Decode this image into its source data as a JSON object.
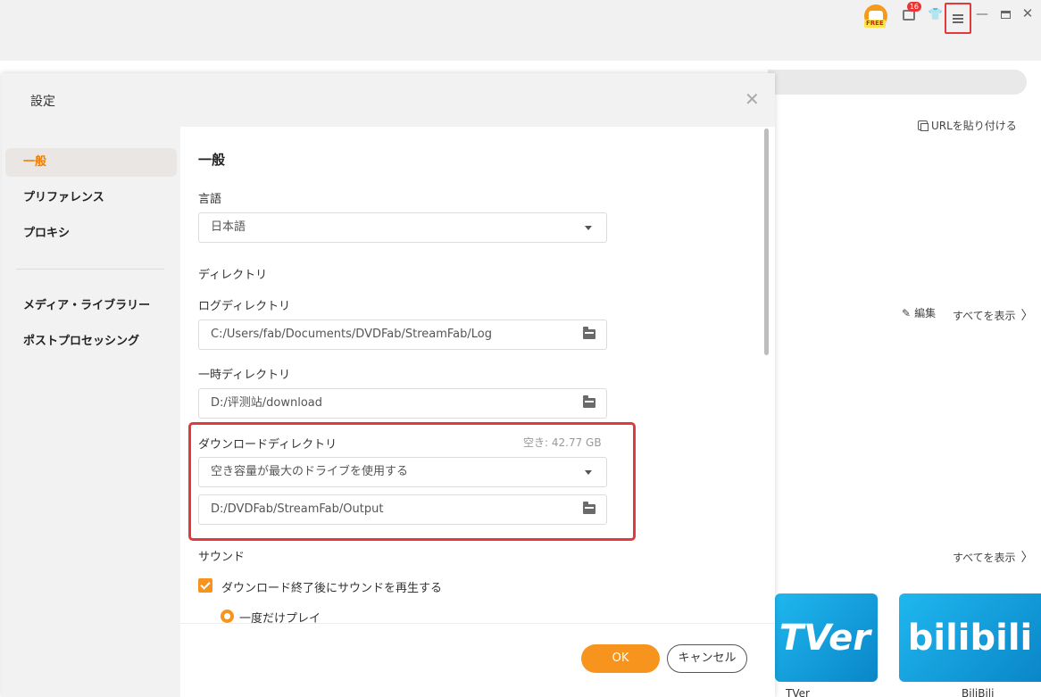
{
  "titlebar": {
    "free_badge": "FREE",
    "gift_count": "16",
    "icons": [
      "free-badge-icon",
      "gift-icon",
      "tshirt-icon",
      "menu-icon",
      "minimize-icon",
      "maximize-icon",
      "close-icon"
    ]
  },
  "background": {
    "paste_url": "URLを貼り付ける",
    "edit": "編集",
    "show_all_1": "すべてを表示",
    "show_all_2": "すべてを表示",
    "card_tver_logo": "TVer",
    "card_tver_label": "TVer",
    "card_bili_logo": "bilibili",
    "card_bili_label": "BiliBili"
  },
  "dialog": {
    "title": "設定",
    "close_glyph": "✕"
  },
  "sidebar": {
    "items": [
      {
        "label": "一般",
        "active": true
      },
      {
        "label": "プリファレンス",
        "active": false
      },
      {
        "label": "プロキシ",
        "active": false
      },
      {
        "label": "メディア・ライブラリー",
        "active": false
      },
      {
        "label": "ポストプロセッシング",
        "active": false
      }
    ]
  },
  "general": {
    "heading": "一般",
    "language_label": "言語",
    "language_value": "日本語",
    "directory_heading": "ディレクトリ",
    "log_dir_label": "ログディレクトリ",
    "log_dir_value": "C:/Users/fab/Documents/DVDFab/StreamFab/Log",
    "temp_dir_label": "一時ディレクトリ",
    "temp_dir_value": "D:/评测站/download",
    "download_dir_label": "ダウンロードディレクトリ",
    "free_space": "空き: 42.77 GB",
    "download_drive_option": "空き容量が最大のドライブを使用する",
    "download_dir_value": "D:/DVDFab/StreamFab/Output",
    "sound_heading": "サウンド",
    "sound_checkbox_label": "ダウンロード終了後にサウンドを再生する",
    "sound_checked": true,
    "play_once_label": "一度だけプレイ"
  },
  "footer": {
    "ok": "OK",
    "cancel": "キャンセル"
  },
  "colors": {
    "accent": "#f7941d",
    "active_text": "#f07d00",
    "highlight": "#e0393e",
    "tver_blue": "#1fb7ef"
  }
}
